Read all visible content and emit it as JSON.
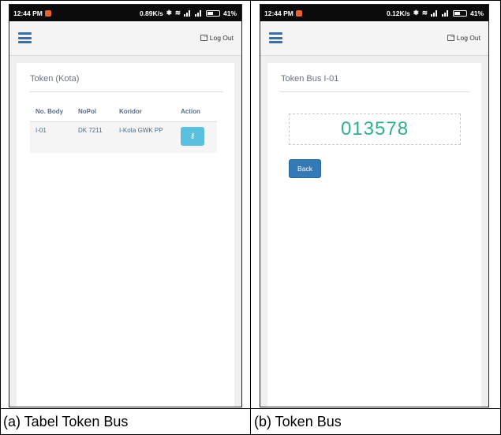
{
  "captions": {
    "a": "(a)  Tabel Token Bus",
    "b": "(b)  Token Bus"
  },
  "colors": {
    "accent": "#337ab7",
    "info_button": "#5bc0de",
    "token_text": "#2fae91"
  },
  "screen_a": {
    "status": {
      "time": "12:44 PM",
      "speed": "0.89K/s",
      "battery": "41%"
    },
    "appbar": {
      "menu_icon": "hamburger-icon",
      "logout_label": "Log Out",
      "logout_icon": "sign-out-icon"
    },
    "card": {
      "title": "Token (Kota)",
      "table": {
        "headers": {
          "no_body": "No. Body",
          "nopol": "NoPol",
          "koridor": "Koridor",
          "action": "Action"
        },
        "rows": [
          {
            "no_body": "I-01",
            "nopol": "DK 7211",
            "koridor": "I-Kota GWK PP",
            "action_icon": "key-icon"
          }
        ]
      }
    }
  },
  "screen_b": {
    "status": {
      "time": "12:44 PM",
      "speed": "0.12K/s",
      "battery": "41%"
    },
    "appbar": {
      "menu_icon": "hamburger-icon",
      "logout_label": "Log Out",
      "logout_icon": "sign-out-icon"
    },
    "card": {
      "title": "Token Bus I-01",
      "token": "013578",
      "back_label": "Back"
    }
  }
}
